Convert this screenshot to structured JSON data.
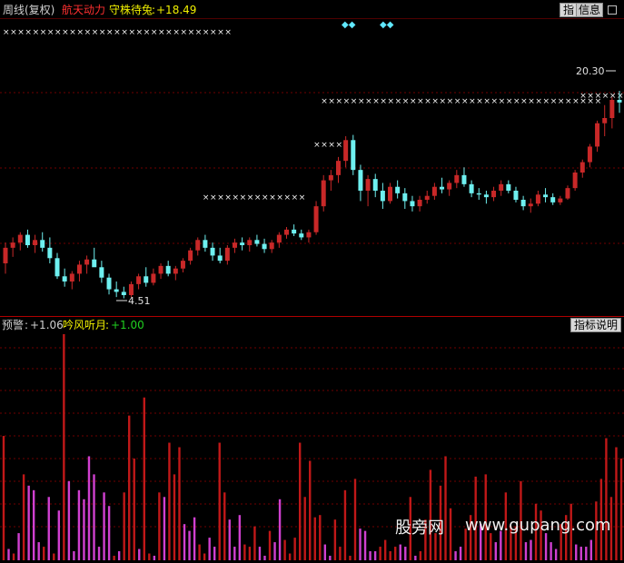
{
  "header": {
    "period_label": "周线(复权)",
    "indicator_name": "航天动力",
    "line_label": "守株待兔",
    "line_value": "+18.49",
    "btn_zhi": "指",
    "btn_info": "信息"
  },
  "sub_header": {
    "alert_label": "预警",
    "alert_value": "+1.06",
    "series_label": "吟风听月",
    "series_value": "+1.00",
    "help_button": "指标说明"
  },
  "watermark": {
    "cn": "股旁网",
    "url": "www.gupang.com"
  },
  "colors": {
    "up": "#c82828",
    "down": "#6ef0f0",
    "magenta": "#d040d0",
    "red_bar": "#c01818",
    "marker": "#f0f0f0",
    "header_red": "#ff3030",
    "header_yellow": "#f0f000",
    "header_green": "#20d020",
    "header_gray": "#d0d0d0",
    "diamond": "#60e8ff"
  },
  "chart_data": [
    {
      "type": "candlestick",
      "price_labels": {
        "high": "20.30",
        "low": "4.51"
      },
      "ylim": [
        3.5,
        24.5
      ],
      "candles": [
        [
          7.0,
          8.6,
          6.2,
          8.2
        ],
        [
          8.2,
          9.0,
          7.5,
          8.6
        ],
        [
          8.6,
          9.4,
          8.0,
          9.2
        ],
        [
          9.2,
          9.6,
          8.2,
          8.4
        ],
        [
          8.4,
          9.2,
          7.8,
          8.8
        ],
        [
          8.8,
          9.4,
          7.9,
          8.2
        ],
        [
          8.2,
          9.0,
          7.0,
          7.4
        ],
        [
          7.4,
          7.8,
          5.8,
          6.0
        ],
        [
          6.0,
          6.6,
          5.2,
          5.6
        ],
        [
          5.6,
          6.4,
          5.0,
          6.2
        ],
        [
          6.2,
          7.2,
          5.6,
          6.9
        ],
        [
          6.9,
          7.6,
          6.2,
          7.3
        ],
        [
          7.3,
          8.2,
          6.9,
          6.7
        ],
        [
          6.7,
          7.2,
          5.5,
          5.9
        ],
        [
          5.9,
          6.2,
          4.6,
          5.0
        ],
        [
          5.0,
          5.6,
          4.4,
          4.8
        ],
        [
          4.8,
          5.2,
          4.3,
          4.55
        ],
        [
          4.55,
          5.6,
          4.4,
          5.4
        ],
        [
          5.4,
          6.2,
          5.0,
          6.0
        ],
        [
          6.0,
          6.7,
          5.2,
          5.5
        ],
        [
          5.5,
          6.6,
          5.3,
          6.2
        ],
        [
          6.2,
          7.0,
          5.8,
          6.8
        ],
        [
          6.8,
          7.2,
          6.0,
          6.2
        ],
        [
          6.2,
          6.8,
          5.7,
          6.6
        ],
        [
          6.6,
          7.4,
          6.3,
          7.2
        ],
        [
          7.2,
          8.2,
          6.9,
          8.0
        ],
        [
          8.0,
          9.0,
          7.6,
          8.8
        ],
        [
          8.8,
          9.2,
          7.9,
          8.2
        ],
        [
          8.2,
          8.6,
          7.2,
          7.6
        ],
        [
          7.6,
          8.2,
          7.0,
          7.2
        ],
        [
          7.2,
          8.4,
          6.9,
          8.2
        ],
        [
          8.2,
          8.9,
          7.8,
          8.6
        ],
        [
          8.6,
          9.0,
          8.0,
          8.4
        ],
        [
          8.4,
          9.0,
          7.9,
          8.8
        ],
        [
          8.8,
          9.2,
          8.3,
          8.5
        ],
        [
          8.5,
          8.9,
          7.8,
          8.1
        ],
        [
          8.1,
          8.8,
          7.8,
          8.6
        ],
        [
          8.6,
          9.4,
          8.2,
          9.2
        ],
        [
          9.2,
          9.8,
          8.9,
          9.6
        ],
        [
          9.6,
          10.0,
          9.1,
          9.3
        ],
        [
          9.3,
          9.6,
          8.8,
          9.0
        ],
        [
          9.0,
          9.6,
          8.6,
          9.4
        ],
        [
          9.4,
          11.8,
          9.2,
          11.4
        ],
        [
          11.4,
          13.8,
          11.0,
          13.4
        ],
        [
          13.4,
          14.2,
          12.6,
          13.8
        ],
        [
          13.8,
          15.2,
          13.2,
          14.9
        ],
        [
          14.9,
          16.8,
          14.4,
          16.5
        ],
        [
          16.5,
          16.9,
          13.8,
          14.2
        ],
        [
          14.2,
          14.6,
          11.8,
          12.6
        ],
        [
          12.6,
          13.8,
          11.4,
          13.5
        ],
        [
          13.5,
          13.9,
          12.1,
          12.6
        ],
        [
          12.6,
          13.2,
          11.2,
          11.8
        ],
        [
          11.8,
          13.2,
          11.6,
          12.9
        ],
        [
          12.9,
          13.4,
          12.0,
          12.4
        ],
        [
          12.4,
          12.8,
          11.2,
          11.8
        ],
        [
          11.8,
          12.2,
          11.0,
          11.4
        ],
        [
          11.4,
          12.2,
          11.0,
          11.9
        ],
        [
          11.9,
          12.6,
          11.6,
          12.2
        ],
        [
          12.2,
          13.2,
          11.9,
          12.9
        ],
        [
          12.9,
          13.6,
          12.4,
          12.7
        ],
        [
          12.7,
          13.4,
          12.2,
          13.2
        ],
        [
          13.2,
          14.2,
          12.8,
          13.8
        ],
        [
          13.8,
          14.4,
          12.9,
          13.1
        ],
        [
          13.1,
          13.4,
          12.1,
          12.4
        ],
        [
          12.4,
          12.8,
          11.9,
          12.3
        ],
        [
          12.3,
          12.6,
          11.6,
          12.1
        ],
        [
          12.1,
          12.9,
          11.8,
          12.6
        ],
        [
          12.6,
          13.4,
          12.2,
          13.1
        ],
        [
          13.1,
          13.4,
          12.4,
          12.6
        ],
        [
          12.6,
          12.9,
          11.7,
          11.9
        ],
        [
          11.9,
          12.2,
          11.1,
          11.4
        ],
        [
          11.4,
          12.0,
          10.9,
          11.6
        ],
        [
          11.6,
          12.6,
          11.4,
          12.3
        ],
        [
          12.3,
          12.8,
          11.7,
          12.1
        ],
        [
          12.1,
          12.4,
          11.5,
          11.7
        ],
        [
          11.7,
          12.2,
          11.5,
          12.0
        ],
        [
          12.0,
          13.0,
          11.9,
          12.8
        ],
        [
          12.8,
          14.2,
          12.6,
          14.0
        ],
        [
          14.0,
          15.0,
          13.6,
          14.8
        ],
        [
          14.8,
          16.2,
          14.4,
          16.0
        ],
        [
          16.0,
          18.0,
          15.6,
          17.8
        ],
        [
          17.8,
          19.2,
          16.8,
          18.2
        ],
        [
          18.2,
          19.8,
          17.4,
          19.6
        ],
        [
          19.6,
          20.3,
          18.6,
          19.4
        ]
      ],
      "markers": {
        "upper": [
          [
            0,
            30
          ],
          [
            43,
            45
          ],
          [
            46,
            80
          ]
        ],
        "middle": [
          [
            27,
            40
          ]
        ],
        "lower": [
          [
            42,
            45
          ],
          [
            78,
            79
          ],
          [
            80,
            83
          ]
        ]
      }
    },
    {
      "type": "bar",
      "ylim": [
        0,
        100
      ],
      "series": [
        {
          "color_key": "red_bar",
          "values": [
            55,
            0,
            0,
            0,
            0,
            0,
            0,
            0,
            0,
            0,
            0,
            0,
            100,
            0,
            0,
            0,
            0,
            0,
            0,
            0,
            0,
            0,
            0,
            0,
            0,
            0,
            0,
            0,
            65,
            0,
            0,
            0,
            0,
            0,
            0,
            0,
            0,
            0,
            0,
            0,
            0,
            0,
            0,
            0,
            0,
            0,
            0,
            0,
            0,
            0,
            0,
            0,
            0,
            0,
            0,
            0,
            0,
            0,
            0,
            0,
            0,
            0,
            0,
            0,
            0,
            0,
            0,
            0,
            0,
            0,
            0,
            0,
            0,
            0,
            0,
            0,
            0,
            0,
            0,
            0,
            0,
            0,
            0,
            0
          ]
        },
        {
          "color_key": "magenta",
          "values": [
            0,
            0,
            0,
            0,
            0,
            0,
            0,
            10,
            0,
            0,
            0,
            0,
            0,
            0,
            0,
            30,
            0,
            0,
            38,
            0,
            0,
            0,
            0,
            0,
            0,
            0,
            10,
            0,
            0,
            0,
            0,
            0,
            0,
            0,
            0,
            0,
            0,
            0,
            0,
            0,
            0,
            0,
            0,
            0,
            0,
            0,
            0,
            0,
            0,
            0,
            0,
            0,
            0,
            0,
            0,
            0,
            0,
            0,
            0,
            0,
            0,
            0,
            0,
            0,
            0,
            0,
            0,
            0,
            0,
            0,
            0,
            0,
            0,
            0,
            0,
            0,
            0,
            0,
            0,
            0,
            0,
            0,
            0,
            0
          ]
        }
      ],
      "bars": [
        [
          "r",
          55
        ],
        [
          "m",
          5
        ],
        [
          "r",
          3
        ],
        [
          "m",
          12
        ],
        [
          "r",
          38
        ],
        [
          "m",
          33
        ],
        [
          "m",
          31
        ],
        [
          "m",
          8
        ],
        [
          "r",
          6
        ],
        [
          "m",
          28
        ],
        [
          "r",
          3
        ],
        [
          "m",
          22
        ],
        [
          "r",
          100
        ],
        [
          "m",
          35
        ],
        [
          "m",
          4
        ],
        [
          "m",
          31
        ],
        [
          "m",
          27
        ],
        [
          "m",
          46
        ],
        [
          "m",
          38
        ],
        [
          "m",
          6
        ],
        [
          "m",
          30
        ],
        [
          "m",
          24
        ],
        [
          "r",
          2
        ],
        [
          "m",
          4
        ],
        [
          "r",
          30
        ],
        [
          "r",
          64
        ],
        [
          "r",
          45
        ],
        [
          "m",
          5
        ],
        [
          "r",
          72
        ],
        [
          "r",
          3
        ],
        [
          "m",
          2
        ],
        [
          "r",
          30
        ],
        [
          "m",
          28
        ],
        [
          "r",
          52
        ],
        [
          "r",
          38
        ],
        [
          "r",
          50
        ],
        [
          "m",
          16
        ],
        [
          "m",
          13
        ],
        [
          "m",
          19
        ],
        [
          "r",
          7
        ],
        [
          "r",
          3
        ],
        [
          "m",
          10
        ],
        [
          "m",
          6
        ],
        [
          "r",
          52
        ],
        [
          "r",
          30
        ],
        [
          "m",
          18
        ],
        [
          "m",
          6
        ],
        [
          "m",
          20
        ],
        [
          "r",
          7
        ],
        [
          "r",
          6
        ],
        [
          "r",
          15
        ],
        [
          "m",
          6
        ],
        [
          "m",
          2
        ],
        [
          "r",
          13
        ],
        [
          "m",
          8
        ],
        [
          "m",
          27
        ],
        [
          "r",
          9
        ],
        [
          "r",
          3
        ],
        [
          "r",
          10
        ],
        [
          "r",
          52
        ],
        [
          "r",
          28
        ],
        [
          "r",
          44
        ],
        [
          "r",
          19
        ],
        [
          "r",
          20
        ],
        [
          "m",
          7
        ],
        [
          "m",
          2
        ],
        [
          "r",
          18
        ],
        [
          "r",
          6
        ],
        [
          "r",
          31
        ],
        [
          "r",
          2
        ],
        [
          "r",
          36
        ],
        [
          "m",
          14
        ],
        [
          "m",
          13
        ],
        [
          "m",
          4
        ],
        [
          "m",
          4
        ],
        [
          "r",
          6
        ],
        [
          "r",
          9
        ],
        [
          "r",
          4
        ],
        [
          "r",
          6
        ],
        [
          "m",
          7
        ],
        [
          "m",
          6
        ],
        [
          "r",
          28
        ],
        [
          "m",
          2
        ],
        [
          "r",
          4
        ],
        [
          "r",
          18
        ],
        [
          "r",
          40
        ],
        [
          "r",
          12
        ],
        [
          "r",
          33
        ],
        [
          "r",
          46
        ],
        [
          "r",
          23
        ],
        [
          "m",
          4
        ],
        [
          "m",
          6
        ],
        [
          "r",
          14
        ],
        [
          "r",
          20
        ],
        [
          "r",
          37
        ],
        [
          "m",
          16
        ],
        [
          "r",
          38
        ],
        [
          "r",
          12
        ],
        [
          "m",
          8
        ],
        [
          "m",
          13
        ],
        [
          "r",
          30
        ],
        [
          "r",
          15
        ],
        [
          "r",
          15
        ],
        [
          "r",
          35
        ],
        [
          "m",
          8
        ],
        [
          "m",
          9
        ],
        [
          "r",
          25
        ],
        [
          "r",
          22
        ],
        [
          "m",
          12
        ],
        [
          "m",
          8
        ],
        [
          "m",
          5
        ],
        [
          "r",
          16
        ],
        [
          "r",
          20
        ],
        [
          "r",
          25
        ],
        [
          "m",
          7
        ],
        [
          "m",
          6
        ],
        [
          "m",
          6
        ],
        [
          "m",
          9
        ],
        [
          "r",
          26
        ],
        [
          "r",
          36
        ],
        [
          "r",
          54
        ],
        [
          "r",
          28
        ],
        [
          "r",
          50
        ],
        [
          "r",
          45
        ]
      ]
    }
  ]
}
